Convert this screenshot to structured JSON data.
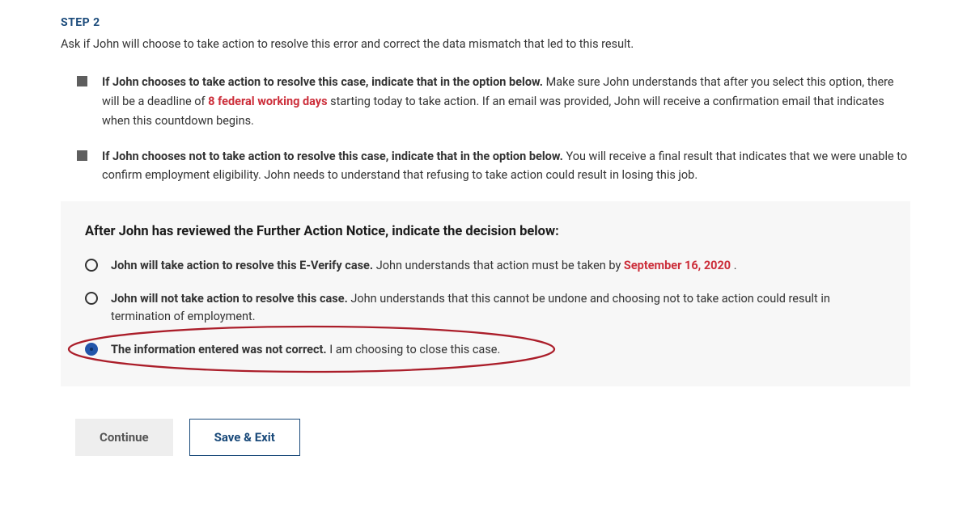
{
  "step": {
    "label": "STEP 2",
    "description": "Ask if John will choose to take action to resolve this error and correct the data mismatch that led to this result."
  },
  "bullets": [
    {
      "bold_lead": "If John chooses to take action to resolve this case, indicate that in the option below.",
      "text_before": " Make sure John understands that after you select this option, there will be a deadline of ",
      "red_phrase": "8 federal working days",
      "text_after": " starting today to take action. If an email was provided, John will receive a confirmation email that indicates when this countdown begins."
    },
    {
      "bold_lead": "If John chooses not to take action to resolve this case, indicate that in the option below.",
      "text": " You will receive a final result that indicates that we were unable to confirm employment eligibility. John needs to understand that refusing to take action could result in losing this job."
    }
  ],
  "decision": {
    "title": "After John has reviewed the Further Action Notice, indicate the decision below:",
    "options": [
      {
        "bold": "John will take action to resolve this E-Verify case.",
        "text_before": " John understands that action must be taken by ",
        "red_phrase": "September 16, 2020",
        "text_after": ".",
        "selected": false
      },
      {
        "bold": "John will not take action to resolve this case.",
        "text": " John understands that this cannot be undone and choosing not to take action could result in termination of employment.",
        "selected": false
      },
      {
        "bold": "The information entered was not correct.",
        "text": " I am choosing to close this case.",
        "selected": true
      }
    ]
  },
  "buttons": {
    "continue": "Continue",
    "save_exit": "Save & Exit"
  },
  "colors": {
    "step_blue": "#1a4a7a",
    "red": "#cc2e3a",
    "selected_radio": "#2255aa",
    "annotation": "#ab1e2a"
  }
}
